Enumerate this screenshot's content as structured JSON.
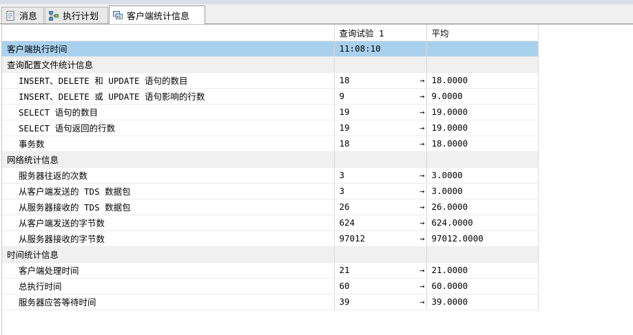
{
  "tabs": [
    {
      "label": "消息",
      "icon": "message-document-icon"
    },
    {
      "label": "执行计划",
      "icon": "execution-plan-icon"
    },
    {
      "label": "客户端统计信息",
      "icon": "client-statistics-icon"
    }
  ],
  "grid": {
    "headers": {
      "label": "",
      "trial": "查询试验 1",
      "avg": "平均"
    },
    "trend_glyph": "→",
    "rows": [
      {
        "kind": "selected",
        "label": "客户端执行时间",
        "trial": "11:08:10",
        "avg": ""
      },
      {
        "kind": "section",
        "label": "查询配置文件统计信息",
        "trial": "",
        "avg": ""
      },
      {
        "kind": "sub",
        "label": "INSERT、DELETE 和 UPDATE 语句的数目",
        "trial": "18",
        "avg": "18.0000"
      },
      {
        "kind": "sub",
        "label": "INSERT、DELETE 或 UPDATE 语句影响的行数",
        "trial": "9",
        "avg": "9.0000"
      },
      {
        "kind": "sub",
        "label": "SELECT 语句的数目",
        "trial": "19",
        "avg": "19.0000"
      },
      {
        "kind": "sub",
        "label": "SELECT 语句返回的行数",
        "trial": "19",
        "avg": "19.0000"
      },
      {
        "kind": "sub",
        "label": "事务数",
        "trial": "18",
        "avg": "18.0000"
      },
      {
        "kind": "section",
        "label": "网络统计信息",
        "trial": "",
        "avg": ""
      },
      {
        "kind": "sub",
        "label": "服务器往返的次数",
        "trial": "3",
        "avg": "3.0000"
      },
      {
        "kind": "sub",
        "label": "从客户端发送的 TDS 数据包",
        "trial": "3",
        "avg": "3.0000"
      },
      {
        "kind": "sub",
        "label": "从服务器接收的 TDS 数据包",
        "trial": "26",
        "avg": "26.0000"
      },
      {
        "kind": "sub",
        "label": "从客户端发送的字节数",
        "trial": "624",
        "avg": "624.0000"
      },
      {
        "kind": "sub",
        "label": "从服务器接收的字节数",
        "trial": "97012",
        "avg": "97012.0000"
      },
      {
        "kind": "section",
        "label": "时间统计信息",
        "trial": "",
        "avg": ""
      },
      {
        "kind": "sub",
        "label": "客户端处理时间",
        "trial": "21",
        "avg": "21.0000"
      },
      {
        "kind": "sub",
        "label": "总执行时间",
        "trial": "60",
        "avg": "60.0000"
      },
      {
        "kind": "sub",
        "label": "服务器应答等待时间",
        "trial": "39",
        "avg": "39.0000"
      }
    ]
  },
  "colors": {
    "selected_row": "#a9d1ee",
    "section_row": "#f0f0f0"
  }
}
